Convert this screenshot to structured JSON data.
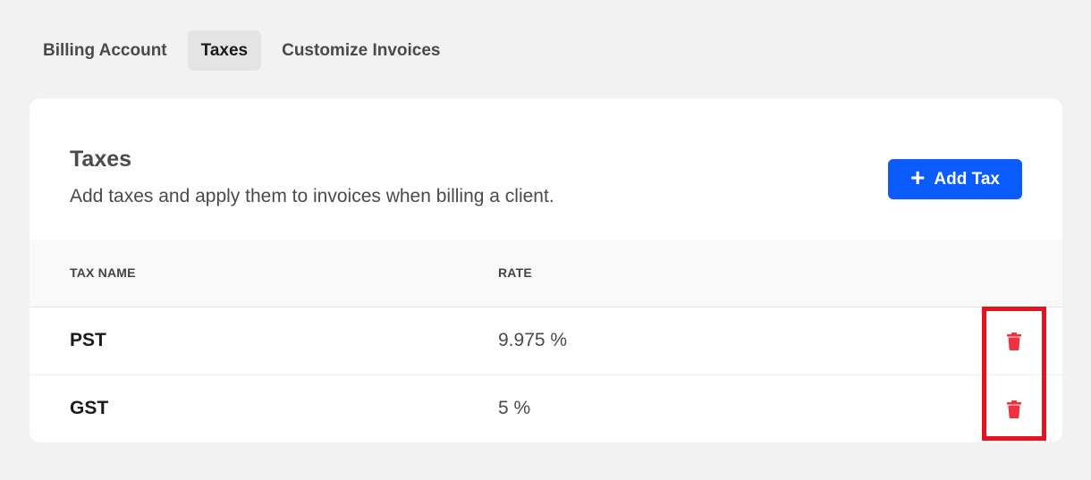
{
  "tabs": [
    {
      "label": "Billing Account",
      "active": false
    },
    {
      "label": "Taxes",
      "active": true
    },
    {
      "label": "Customize Invoices",
      "active": false
    }
  ],
  "taxes_card": {
    "title": "Taxes",
    "description": "Add taxes and apply them to invoices when billing a client.",
    "add_button_label": "Add Tax",
    "columns": {
      "name": "TAX NAME",
      "rate": "RATE"
    },
    "rows": [
      {
        "name": "PST",
        "rate": "9.975 %"
      },
      {
        "name": "GST",
        "rate": "5 %"
      }
    ]
  },
  "colors": {
    "accent": "#0a5cff",
    "delete_icon": "#ee3340",
    "highlight_box": "#e8121f"
  },
  "icons": {
    "add": "plus-icon",
    "delete": "trash-icon"
  }
}
